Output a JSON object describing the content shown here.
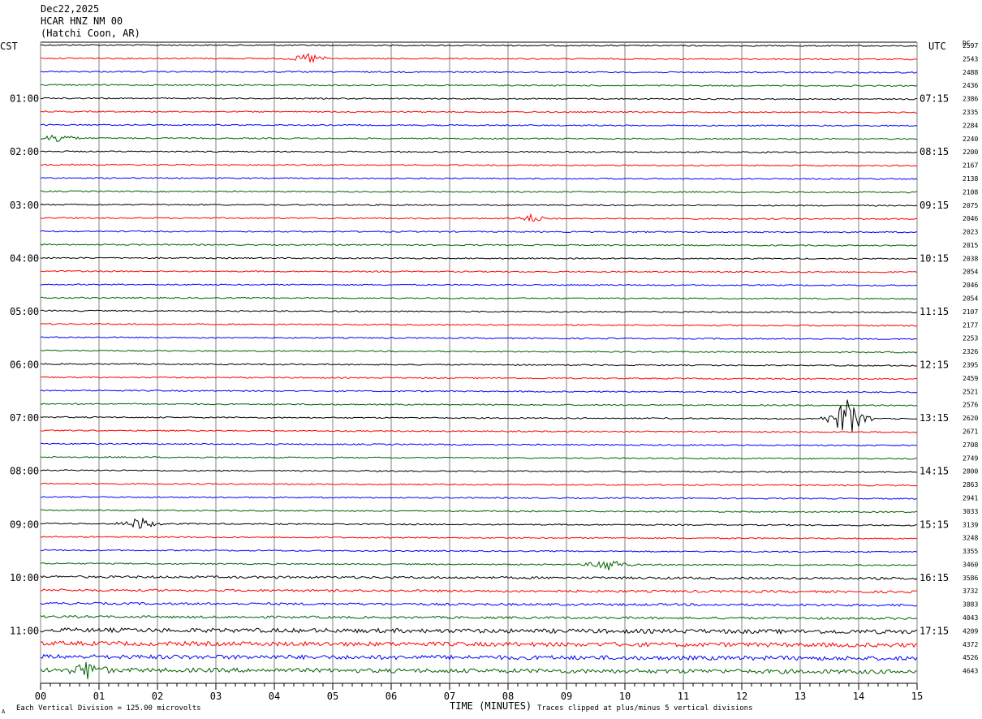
{
  "header": {
    "date": "Dec22,2025",
    "station": "HCAR HNZ NM 00",
    "location": "(Hatchi Coon, AR)"
  },
  "left_zone": "CST",
  "right_zone": "UTC",
  "dc_label": "DC",
  "footer": {
    "scale_note": "Each Vertical Division =  125.00 microvolts",
    "clip_note": "Traces clipped at plus/minus 5 vertical divisions",
    "corner_mark": "A"
  },
  "colors": {
    "trace_cycle": [
      "#000000",
      "#ff0000",
      "#0000ff",
      "#006400"
    ],
    "grid": "#808080",
    "background": "#ffffff"
  },
  "chart_data": {
    "type": "line",
    "title": "",
    "xlabel": "TIME (MINUTES)",
    "xlim": [
      0,
      15
    ],
    "x_ticks": [
      "00",
      "01",
      "02",
      "03",
      "04",
      "05",
      "06",
      "07",
      "08",
      "09",
      "10",
      "11",
      "12",
      "13",
      "14",
      "15"
    ],
    "rows_per_hour": 4,
    "row_count": 48,
    "left_hour_labels": [
      "01:00",
      "02:00",
      "03:00",
      "04:00",
      "05:00",
      "06:00",
      "07:00",
      "08:00",
      "09:00",
      "10:00",
      "11:00"
    ],
    "right_hour_labels": [
      "07:15",
      "08:15",
      "09:15",
      "10:15",
      "11:15",
      "12:15",
      "13:15",
      "14:15",
      "15:15",
      "16:15",
      "17:15"
    ],
    "dc_offsets": [
      2597,
      2543,
      2488,
      2436,
      2386,
      2335,
      2284,
      2240,
      2200,
      2167,
      2138,
      2108,
      2075,
      2046,
      2023,
      2015,
      2038,
      2054,
      2046,
      2054,
      2107,
      2177,
      2253,
      2326,
      2395,
      2459,
      2521,
      2576,
      2620,
      2671,
      2708,
      2749,
      2800,
      2863,
      2941,
      3033,
      3139,
      3248,
      3355,
      3460,
      3586,
      3732,
      3883,
      4043,
      4209,
      4372,
      4526,
      4643
    ],
    "events": [
      {
        "row": 1,
        "minute": 4.6,
        "amplitude": 0.5
      },
      {
        "row": 7,
        "minute": 0.3,
        "amplitude": 0.45
      },
      {
        "row": 13,
        "minute": 8.4,
        "amplitude": 0.35
      },
      {
        "row": 28,
        "minute": 13.8,
        "amplitude": 2.0
      },
      {
        "row": 36,
        "minute": 1.7,
        "amplitude": 0.6
      },
      {
        "row": 39,
        "minute": 9.7,
        "amplitude": 0.7
      },
      {
        "row": 47,
        "minute": 0.8,
        "amplitude": 0.8
      }
    ]
  }
}
